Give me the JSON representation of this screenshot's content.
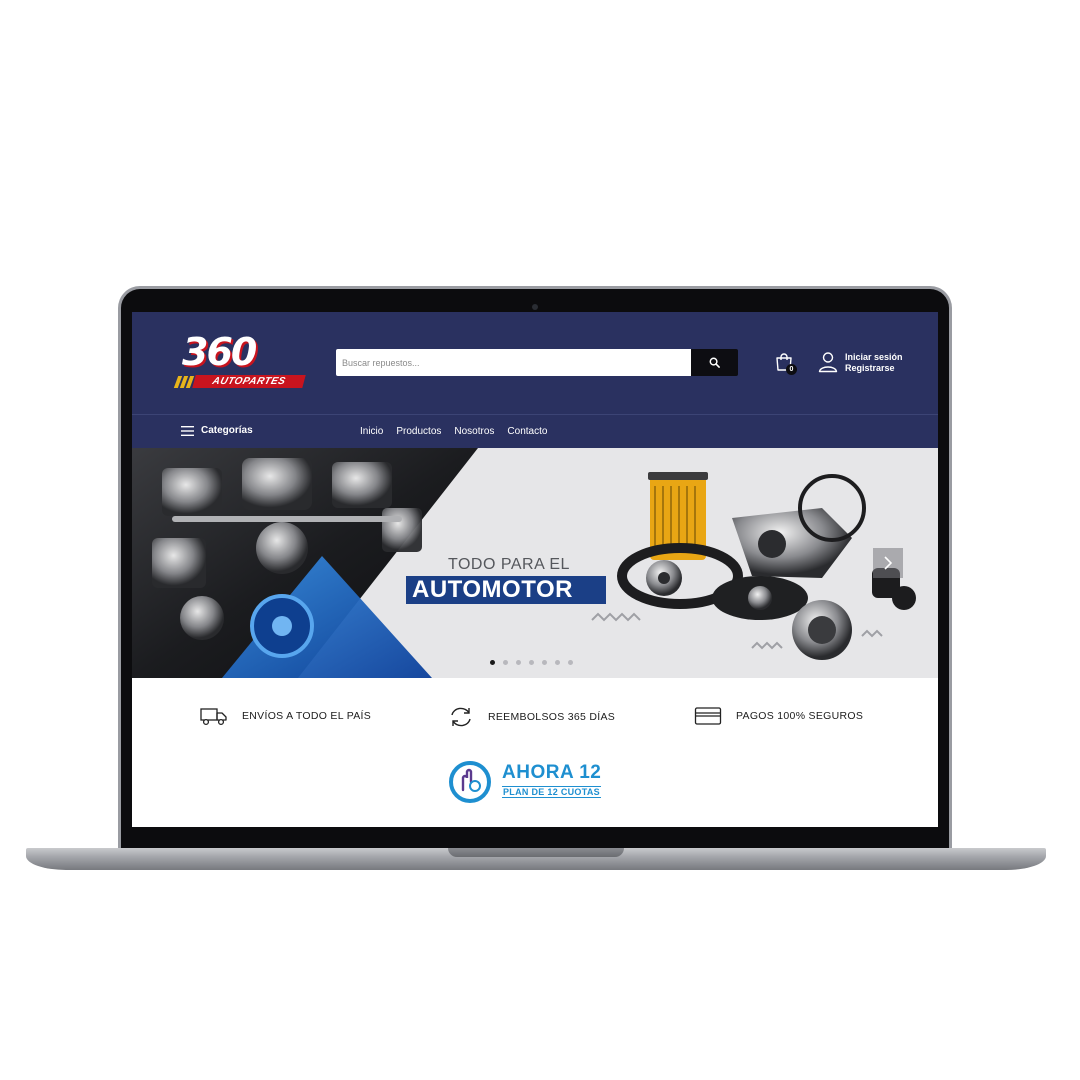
{
  "brand": {
    "logo_number": "360",
    "logo_text": "AUTOPARTES"
  },
  "search": {
    "placeholder": "Buscar repuestos...",
    "button_icon": "search-icon"
  },
  "header": {
    "cart_icon": "shopping-bag-icon",
    "cart_count": "0",
    "user_icon": "user-icon",
    "login_label": "Iniciar sesión",
    "register_label": "Registrarse"
  },
  "nav": {
    "categories_label": "Categorías",
    "links": [
      "Inicio",
      "Productos",
      "Nosotros",
      "Contacto"
    ]
  },
  "hero": {
    "subtitle": "TODO PARA EL",
    "title": "AUTOMOTOR",
    "slide_count": 7,
    "active_slide": 1
  },
  "features": [
    {
      "icon": "truck-icon",
      "label": "ENVÍOS A TODO EL PAÍS"
    },
    {
      "icon": "refresh-icon",
      "label": "REEMBOLSOS 365 DÍAS"
    },
    {
      "icon": "credit-card-icon",
      "label": "PAGOS 100% SEGUROS"
    }
  ],
  "promo": {
    "title": "AHORA 12",
    "subtitle": "PLAN DE 12 CUOTAS"
  },
  "colors": {
    "header_bg": "#2a3160",
    "accent_red": "#c8141e",
    "hero_blue": "#1b3f86",
    "promo_blue": "#1e8fd0"
  }
}
